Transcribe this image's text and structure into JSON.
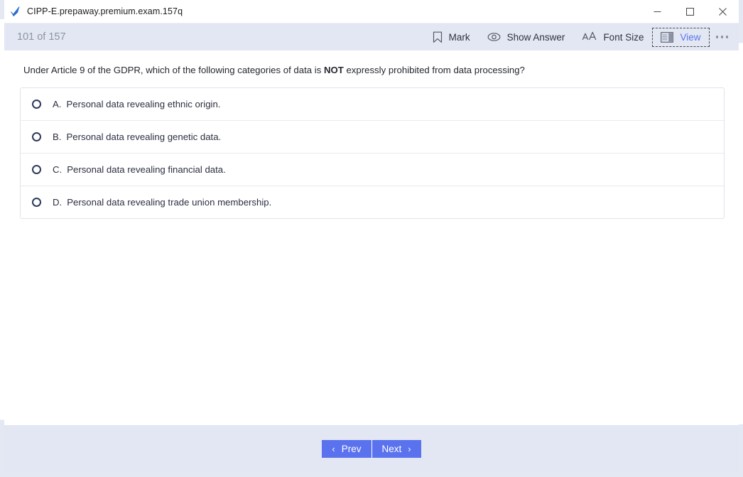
{
  "window": {
    "title": "CIPP-E.prepaway.premium.exam.157q",
    "app_icon": "blue-check-icon",
    "controls": {
      "minimize": "minimize-icon",
      "maximize": "maximize-icon",
      "close": "close-icon"
    }
  },
  "toolbar": {
    "counter": "101 of 157",
    "actions": [
      {
        "label": "Mark",
        "icon": "bookmark-icon",
        "focused": false
      },
      {
        "label": "Show Answer",
        "icon": "eye-icon",
        "focused": false
      },
      {
        "label": "Font Size",
        "icon": "font-size-icon",
        "focused": false
      },
      {
        "label": "View",
        "icon": "layout-panel-icon",
        "focused": true
      }
    ],
    "more_label": "more-options"
  },
  "question": {
    "prefix": "Under Article 9 of the GDPR, which of the following categories of data is ",
    "emphasis": "NOT",
    "suffix": " expressly prohibited from data processing?",
    "options": [
      {
        "letter": "A.",
        "text": "Personal data revealing ethnic origin.",
        "selected": false
      },
      {
        "letter": "B.",
        "text": "Personal data revealing genetic data.",
        "selected": false
      },
      {
        "letter": "C.",
        "text": "Personal data revealing financial data.",
        "selected": false
      },
      {
        "letter": "D.",
        "text": "Personal data revealing trade union membership.",
        "selected": false
      }
    ]
  },
  "footer": {
    "prev_label": "Prev",
    "next_label": "Next",
    "prev_chevron": "‹",
    "next_chevron": "›"
  },
  "colors": {
    "toolbar_bg": "#e2e7f3",
    "accent_blue": "#5b72ef",
    "link_blue": "#5b76e8",
    "counter_gray": "#8e94a3",
    "text_dark": "#24282f"
  }
}
